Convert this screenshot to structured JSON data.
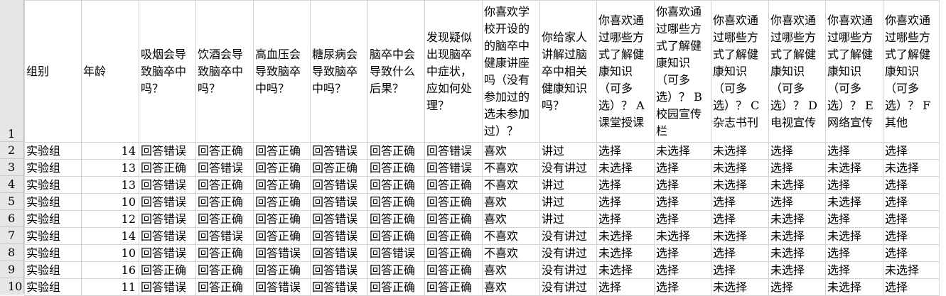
{
  "sheet": {
    "row_numbers": [
      "1",
      "2",
      "3",
      "4",
      "5",
      "6",
      "7",
      "8",
      "9",
      "10"
    ],
    "headers": [
      "组别",
      "年龄",
      "吸烟会导致脑卒中吗？",
      "饮酒会导致脑卒中吗？",
      "高血压会导致脑卒中吗？",
      "糖尿病会导致脑卒中吗？",
      "脑卒中会导致什么后果？",
      "发现疑似出现脑卒中症状，应如何处理？",
      "你喜欢学校开设的的脑卒中健康讲座吗（没有参加过的选未参加过）？",
      "你给家人讲解过脑卒中相关健康知识吗？",
      "你喜欢通过哪些方式了解健康知识（可多选）？ A 课堂授课",
      "你喜欢通过哪些方式了解健康知识（可多选）？ B 校园宣传栏",
      "你喜欢通过哪些方式了解健康知识（可多选）？ C 杂志书刊",
      "你喜欢通过哪些方式了解健康知识（可多选）？ D 电视宣传",
      "你喜欢通过哪些方式了解健康知识（可多选）？ E 网络宣传",
      "你喜欢通过哪些方式了解健康知识（可多选）？ F 其他"
    ],
    "rows": [
      [
        "实验组",
        "14",
        "回答错误",
        "回答正确",
        "回答正确",
        "回答错误",
        "回答正确",
        "回答错误",
        "喜欢",
        "讲过",
        "选择",
        "未选择",
        "未选择",
        "选择",
        "选择",
        "选择"
      ],
      [
        "实验组",
        "13",
        "回答正确",
        "回答错误",
        "回答正确",
        "回答正确",
        "回答正确",
        "回答错误",
        "不喜欢",
        "没有讲过",
        "未选择",
        "选择",
        "未选择",
        "选择",
        "未选择",
        "未选择"
      ],
      [
        "实验组",
        "13",
        "回答错误",
        "回答正确",
        "回答正确",
        "回答错误",
        "回答正确",
        "回答正确",
        "不喜欢",
        "讲过",
        "选择",
        "选择",
        "未选择",
        "未选择",
        "选择",
        "选择"
      ],
      [
        "实验组",
        "10",
        "回答错误",
        "回答正确",
        "回答正确",
        "回答错误",
        "回答正确",
        "回答正确",
        "喜欢",
        "讲过",
        "选择",
        "选择",
        "选择",
        "选择",
        "未选择",
        "选择"
      ],
      [
        "实验组",
        "12",
        "回答错误",
        "回答正确",
        "回答正确",
        "回答错误",
        "回答正确",
        "回答正确",
        "喜欢",
        "讲过",
        "选择",
        "选择",
        "选择",
        "未选择",
        "选择",
        "选择"
      ],
      [
        "实验组",
        "14",
        "回答错误",
        "回答错误",
        "回答正确",
        "回答错误",
        "回答正确",
        "回答正确",
        "不喜欢",
        "没有讲过",
        "未选择",
        "未选择",
        "未选择",
        "未选择",
        "未选择",
        "选择"
      ],
      [
        "实验组",
        "10",
        "回答错误",
        "回答正确",
        "回答错误",
        "回答错误",
        "回答错误",
        "回答正确",
        "不喜欢",
        "没有讲过",
        "未选择",
        "选择",
        "选择",
        "未选择",
        "选择",
        "选择"
      ],
      [
        "实验组",
        "16",
        "回答正确",
        "回答正确",
        "回答正确",
        "回答错误",
        "回答正确",
        "回答正确",
        "喜欢",
        "没有讲过",
        "未选择",
        "选择",
        "选择",
        "未选择",
        "选择",
        "未选择"
      ],
      [
        "实验组",
        "11",
        "回答错误",
        "回答正确",
        "回答错误",
        "回答错误",
        "回答正确",
        "回答正确",
        "喜欢",
        "没有讲过",
        "选择",
        "选择",
        "未选择",
        "选择",
        "未选择",
        "选择"
      ]
    ]
  }
}
